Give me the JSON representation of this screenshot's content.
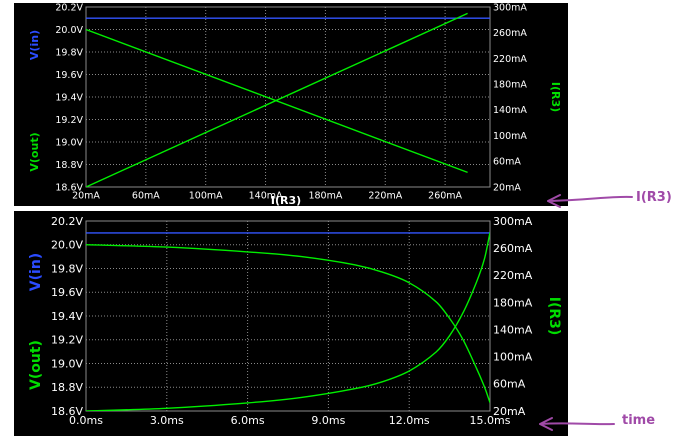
{
  "colors": {
    "panel_bg": "#000000",
    "grid": "#8a8a8a",
    "frame": "#8a8a8a",
    "tick_text": "#ffffff",
    "vin_series": "#3355ff",
    "vout_series": "#00ee00",
    "ir3_series": "#00ee00",
    "vin_label": "#2b4cff",
    "green_label": "#00dd00",
    "annotation": "#a04aa8"
  },
  "chart_data": [
    {
      "type": "line",
      "panel": "top",
      "xlabel": "I(R3)",
      "left_labels": {
        "top": "V(in)",
        "bottom": "V(out)"
      },
      "right_label": "I(R3)",
      "x_ticks": [
        "20mA",
        "60mA",
        "100mA",
        "140mA",
        "180mA",
        "220mA",
        "260mA"
      ],
      "y_left_ticks": [
        "20.2V",
        "20.0V",
        "19.8V",
        "19.6V",
        "19.4V",
        "19.2V",
        "19.0V",
        "18.8V",
        "18.6V"
      ],
      "y_right_ticks": [
        "300mA",
        "260mA",
        "220mA",
        "180mA",
        "140mA",
        "100mA",
        "60mA",
        "20mA"
      ],
      "xlim_mA": [
        20,
        290
      ],
      "ylim_left_V": [
        18.6,
        20.2
      ],
      "ylim_right_mA": [
        20,
        300
      ],
      "grid": true,
      "series": [
        {
          "name": "V(in)",
          "axis": "left",
          "x": [
            20,
            290
          ],
          "y": [
            20.1,
            20.1
          ]
        },
        {
          "name": "V(out)",
          "axis": "left",
          "x": [
            20,
            275
          ],
          "y": [
            20.0,
            18.73
          ]
        },
        {
          "name": "I(R3)",
          "axis": "right",
          "x": [
            20,
            275
          ],
          "y": [
            20,
            290
          ]
        }
      ]
    },
    {
      "type": "line",
      "panel": "bottom",
      "xlabel": "",
      "left_labels": {
        "top": "V(in)",
        "bottom": "V(out)"
      },
      "right_label": "I(R3)",
      "x_ticks": [
        "0.0ms",
        "3.0ms",
        "6.0ms",
        "9.0ms",
        "12.0ms",
        "15.0ms"
      ],
      "y_left_ticks": [
        "20.2V",
        "20.0V",
        "19.8V",
        "19.6V",
        "19.4V",
        "19.2V",
        "19.0V",
        "18.8V",
        "18.6V"
      ],
      "y_right_ticks": [
        "300mA",
        "260mA",
        "220mA",
        "180mA",
        "140mA",
        "100mA",
        "60mA",
        "20mA"
      ],
      "xlim_ms": [
        0,
        15
      ],
      "ylim_left_V": [
        18.6,
        20.2
      ],
      "ylim_right_mA": [
        20,
        300
      ],
      "grid": true,
      "series": [
        {
          "name": "V(in)",
          "axis": "left",
          "x": [
            0,
            15
          ],
          "y": [
            20.1,
            20.1
          ]
        },
        {
          "name": "V(out)",
          "axis": "left",
          "x": [
            0,
            3,
            6,
            8,
            10,
            11,
            12,
            13,
            13.5,
            14,
            14.5,
            14.8,
            15
          ],
          "y": [
            20.0,
            19.98,
            19.94,
            19.9,
            19.83,
            19.77,
            19.68,
            19.52,
            19.38,
            19.2,
            18.96,
            18.8,
            18.67
          ]
        },
        {
          "name": "I(R3)",
          "axis": "right",
          "x": [
            0,
            3,
            6,
            8,
            10,
            11,
            12,
            13,
            13.5,
            14,
            14.5,
            14.8,
            15
          ],
          "y": [
            20,
            24,
            32,
            40,
            53,
            63,
            79,
            107,
            131,
            165,
            210,
            245,
            283
          ]
        }
      ]
    }
  ],
  "annotations": {
    "top_arrow_label": "I(R3)",
    "bottom_arrow_label": "time"
  }
}
